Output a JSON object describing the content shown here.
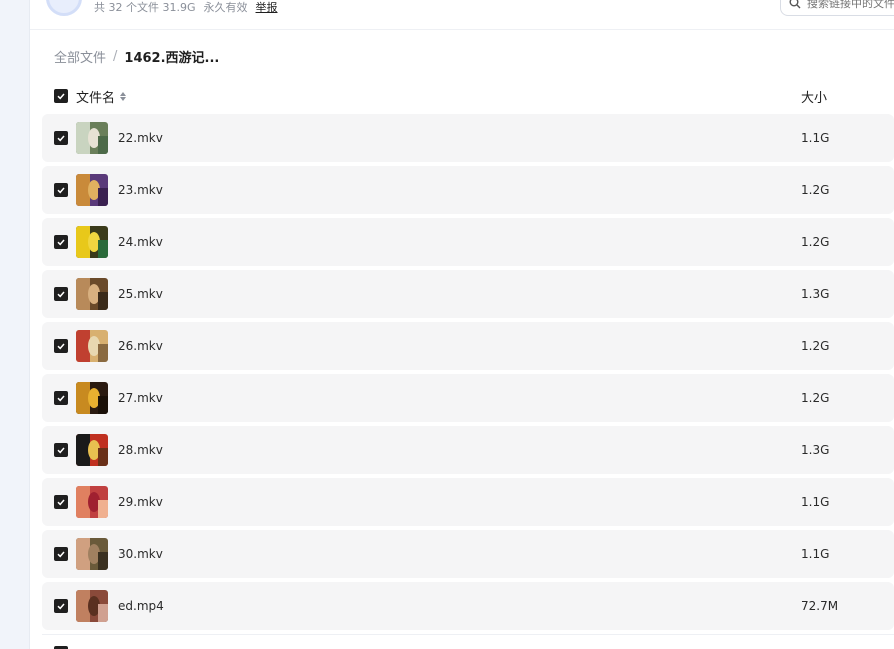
{
  "share_header": {
    "file_count_text": "共 32 个文件 31.9G",
    "validity_text": "永久有效",
    "report_label": "举报"
  },
  "search": {
    "placeholder": "搜索链接中的文件"
  },
  "breadcrumb": {
    "root": "全部文件",
    "separator": "/",
    "current": "1462.西游记..."
  },
  "list_header": {
    "name_label": "文件名",
    "size_label": "大小"
  },
  "files": [
    {
      "name": "22.mkv",
      "size": "1.1G",
      "checked": true
    },
    {
      "name": "23.mkv",
      "size": "1.2G",
      "checked": true
    },
    {
      "name": "24.mkv",
      "size": "1.2G",
      "checked": true
    },
    {
      "name": "25.mkv",
      "size": "1.3G",
      "checked": true
    },
    {
      "name": "26.mkv",
      "size": "1.2G",
      "checked": true
    },
    {
      "name": "27.mkv",
      "size": "1.2G",
      "checked": true
    },
    {
      "name": "28.mkv",
      "size": "1.3G",
      "checked": true
    },
    {
      "name": "29.mkv",
      "size": "1.1G",
      "checked": true
    },
    {
      "name": "30.mkv",
      "size": "1.1G",
      "checked": true
    },
    {
      "name": "ed.mp4",
      "size": "72.7M",
      "checked": true
    }
  ],
  "colors": {
    "checkbox": "#1f1f1f",
    "row_bg": "#f5f5f6",
    "muted_text": "#8a8f99"
  }
}
